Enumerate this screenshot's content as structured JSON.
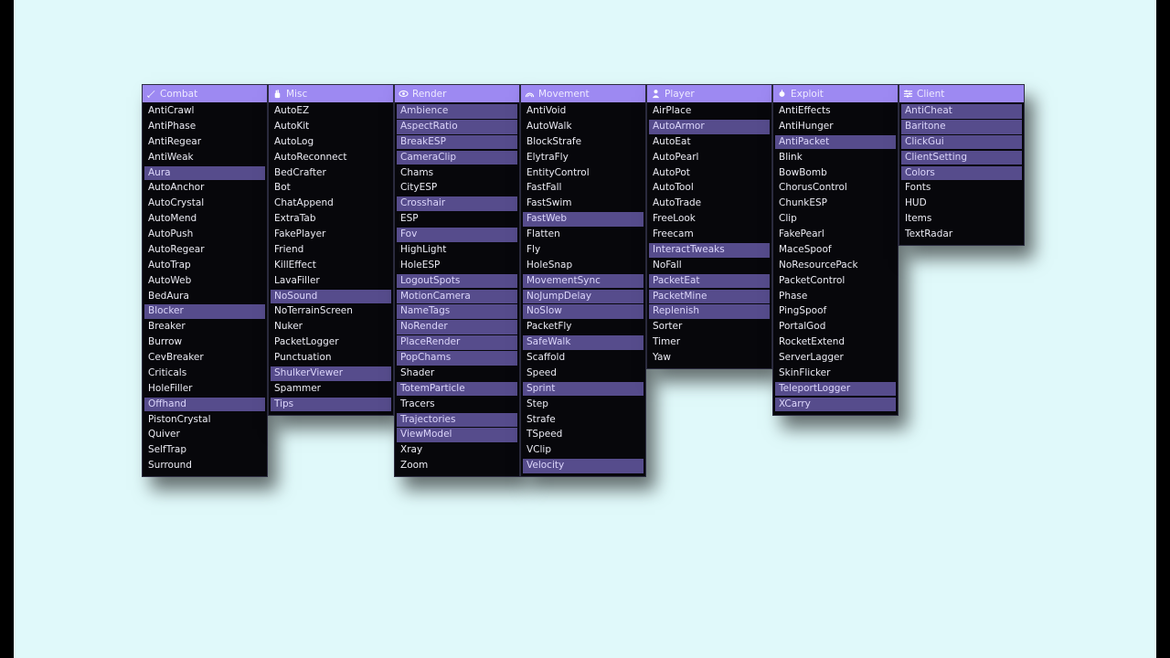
{
  "colors": {
    "background": "#e0f9fa",
    "header": "#9d89f2",
    "panel": "#07070b",
    "enabled": "#564c8c"
  },
  "panels": [
    {
      "name": "Combat",
      "icon": "sword-icon",
      "modules": [
        {
          "label": "AntiCrawl",
          "enabled": false
        },
        {
          "label": "AntiPhase",
          "enabled": false
        },
        {
          "label": "AntiRegear",
          "enabled": false
        },
        {
          "label": "AntiWeak",
          "enabled": false
        },
        {
          "label": "Aura",
          "enabled": true
        },
        {
          "label": "AutoAnchor",
          "enabled": false
        },
        {
          "label": "AutoCrystal",
          "enabled": false
        },
        {
          "label": "AutoMend",
          "enabled": false
        },
        {
          "label": "AutoPush",
          "enabled": false
        },
        {
          "label": "AutoRegear",
          "enabled": false
        },
        {
          "label": "AutoTrap",
          "enabled": false
        },
        {
          "label": "AutoWeb",
          "enabled": false
        },
        {
          "label": "BedAura",
          "enabled": false
        },
        {
          "label": "Blocker",
          "enabled": true
        },
        {
          "label": "Breaker",
          "enabled": false
        },
        {
          "label": "Burrow",
          "enabled": false
        },
        {
          "label": "CevBreaker",
          "enabled": false
        },
        {
          "label": "Criticals",
          "enabled": false
        },
        {
          "label": "HoleFiller",
          "enabled": false
        },
        {
          "label": "Offhand",
          "enabled": true
        },
        {
          "label": "PistonCrystal",
          "enabled": false
        },
        {
          "label": "Quiver",
          "enabled": false
        },
        {
          "label": "SelfTrap",
          "enabled": false
        },
        {
          "label": "Surround",
          "enabled": false
        }
      ]
    },
    {
      "name": "Misc",
      "icon": "hand-icon",
      "modules": [
        {
          "label": "AutoEZ",
          "enabled": false
        },
        {
          "label": "AutoKit",
          "enabled": false
        },
        {
          "label": "AutoLog",
          "enabled": false
        },
        {
          "label": "AutoReconnect",
          "enabled": false
        },
        {
          "label": "BedCrafter",
          "enabled": false
        },
        {
          "label": "Bot",
          "enabled": false
        },
        {
          "label": "ChatAppend",
          "enabled": false
        },
        {
          "label": "ExtraTab",
          "enabled": false
        },
        {
          "label": "FakePlayer",
          "enabled": false
        },
        {
          "label": "Friend",
          "enabled": false
        },
        {
          "label": "KillEffect",
          "enabled": false
        },
        {
          "label": "LavaFiller",
          "enabled": false
        },
        {
          "label": "NoSound",
          "enabled": true
        },
        {
          "label": "NoTerrainScreen",
          "enabled": false
        },
        {
          "label": "Nuker",
          "enabled": false
        },
        {
          "label": "PacketLogger",
          "enabled": false
        },
        {
          "label": "Punctuation",
          "enabled": false
        },
        {
          "label": "ShulkerViewer",
          "enabled": true
        },
        {
          "label": "Spammer",
          "enabled": false
        },
        {
          "label": "Tips",
          "enabled": true
        }
      ]
    },
    {
      "name": "Render",
      "icon": "eye-icon",
      "modules": [
        {
          "label": "Ambience",
          "enabled": true
        },
        {
          "label": "AspectRatio",
          "enabled": true
        },
        {
          "label": "BreakESP",
          "enabled": true
        },
        {
          "label": "CameraClip",
          "enabled": true
        },
        {
          "label": "Chams",
          "enabled": false
        },
        {
          "label": "CityESP",
          "enabled": false
        },
        {
          "label": "Crosshair",
          "enabled": true
        },
        {
          "label": "ESP",
          "enabled": false
        },
        {
          "label": "Fov",
          "enabled": true
        },
        {
          "label": "HighLight",
          "enabled": false
        },
        {
          "label": "HoleESP",
          "enabled": false
        },
        {
          "label": "LogoutSpots",
          "enabled": true
        },
        {
          "label": "MotionCamera",
          "enabled": true
        },
        {
          "label": "NameTags",
          "enabled": true
        },
        {
          "label": "NoRender",
          "enabled": true
        },
        {
          "label": "PlaceRender",
          "enabled": true
        },
        {
          "label": "PopChams",
          "enabled": true
        },
        {
          "label": "Shader",
          "enabled": false
        },
        {
          "label": "TotemParticle",
          "enabled": true
        },
        {
          "label": "Tracers",
          "enabled": false
        },
        {
          "label": "Trajectories",
          "enabled": true
        },
        {
          "label": "ViewModel",
          "enabled": true
        },
        {
          "label": "Xray",
          "enabled": false
        },
        {
          "label": "Zoom",
          "enabled": false
        }
      ]
    },
    {
      "name": "Movement",
      "icon": "signal-icon",
      "modules": [
        {
          "label": "AntiVoid",
          "enabled": false
        },
        {
          "label": "AutoWalk",
          "enabled": false
        },
        {
          "label": "BlockStrafe",
          "enabled": false
        },
        {
          "label": "ElytraFly",
          "enabled": false
        },
        {
          "label": "EntityControl",
          "enabled": false
        },
        {
          "label": "FastFall",
          "enabled": false
        },
        {
          "label": "FastSwim",
          "enabled": false
        },
        {
          "label": "FastWeb",
          "enabled": true
        },
        {
          "label": "Flatten",
          "enabled": false
        },
        {
          "label": "Fly",
          "enabled": false
        },
        {
          "label": "HoleSnap",
          "enabled": false
        },
        {
          "label": "MovementSync",
          "enabled": true
        },
        {
          "label": "NoJumpDelay",
          "enabled": true
        },
        {
          "label": "NoSlow",
          "enabled": true
        },
        {
          "label": "PacketFly",
          "enabled": false
        },
        {
          "label": "SafeWalk",
          "enabled": true
        },
        {
          "label": "Scaffold",
          "enabled": false
        },
        {
          "label": "Speed",
          "enabled": false
        },
        {
          "label": "Sprint",
          "enabled": true
        },
        {
          "label": "Step",
          "enabled": false
        },
        {
          "label": "Strafe",
          "enabled": false
        },
        {
          "label": "TSpeed",
          "enabled": false
        },
        {
          "label": "VClip",
          "enabled": false
        },
        {
          "label": "Velocity",
          "enabled": true
        }
      ]
    },
    {
      "name": "Player",
      "icon": "person-icon",
      "modules": [
        {
          "label": "AirPlace",
          "enabled": false
        },
        {
          "label": "AutoArmor",
          "enabled": true
        },
        {
          "label": "AutoEat",
          "enabled": false
        },
        {
          "label": "AutoPearl",
          "enabled": false
        },
        {
          "label": "AutoPot",
          "enabled": false
        },
        {
          "label": "AutoTool",
          "enabled": false
        },
        {
          "label": "AutoTrade",
          "enabled": false
        },
        {
          "label": "FreeLook",
          "enabled": false
        },
        {
          "label": "Freecam",
          "enabled": false
        },
        {
          "label": "InteractTweaks",
          "enabled": true
        },
        {
          "label": "NoFall",
          "enabled": false
        },
        {
          "label": "PacketEat",
          "enabled": true
        },
        {
          "label": "PacketMine",
          "enabled": true
        },
        {
          "label": "Replenish",
          "enabled": true
        },
        {
          "label": "Sorter",
          "enabled": false
        },
        {
          "label": "Timer",
          "enabled": false
        },
        {
          "label": "Yaw",
          "enabled": false
        }
      ]
    },
    {
      "name": "Exploit",
      "icon": "bug-icon",
      "modules": [
        {
          "label": "AntiEffects",
          "enabled": false
        },
        {
          "label": "AntiHunger",
          "enabled": false
        },
        {
          "label": "AntiPacket",
          "enabled": true
        },
        {
          "label": "Blink",
          "enabled": false
        },
        {
          "label": "BowBomb",
          "enabled": false
        },
        {
          "label": "ChorusControl",
          "enabled": false
        },
        {
          "label": "ChunkESP",
          "enabled": false
        },
        {
          "label": "Clip",
          "enabled": false
        },
        {
          "label": "FakePearl",
          "enabled": false
        },
        {
          "label": "MaceSpoof",
          "enabled": false
        },
        {
          "label": "NoResourcePack",
          "enabled": false
        },
        {
          "label": "PacketControl",
          "enabled": false
        },
        {
          "label": "Phase",
          "enabled": false
        },
        {
          "label": "PingSpoof",
          "enabled": false
        },
        {
          "label": "PortalGod",
          "enabled": false
        },
        {
          "label": "RocketExtend",
          "enabled": false
        },
        {
          "label": "ServerLagger",
          "enabled": false
        },
        {
          "label": "SkinFlicker",
          "enabled": false
        },
        {
          "label": "TeleportLogger",
          "enabled": true
        },
        {
          "label": "XCarry",
          "enabled": true
        }
      ]
    },
    {
      "name": "Client",
      "icon": "sliders-icon",
      "modules": [
        {
          "label": "AntiCheat",
          "enabled": true
        },
        {
          "label": "Baritone",
          "enabled": true
        },
        {
          "label": "ClickGui",
          "enabled": true
        },
        {
          "label": "ClientSetting",
          "enabled": true
        },
        {
          "label": "Colors",
          "enabled": true
        },
        {
          "label": "Fonts",
          "enabled": false
        },
        {
          "label": "HUD",
          "enabled": false
        },
        {
          "label": "Items",
          "enabled": false
        },
        {
          "label": "TextRadar",
          "enabled": false
        }
      ]
    }
  ]
}
